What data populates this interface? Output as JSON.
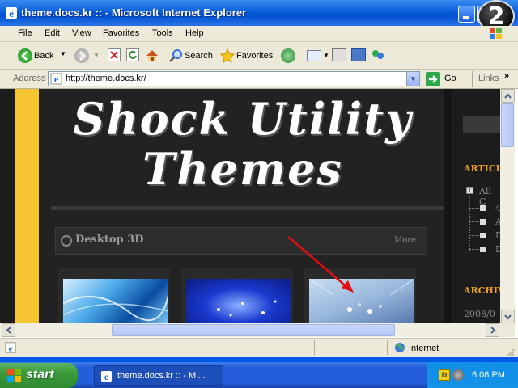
{
  "window": {
    "title": "theme.docs.kr :: - Microsoft Internet Explorer",
    "badge": "2"
  },
  "menu": [
    "File",
    "Edit",
    "View",
    "Favorites",
    "Tools",
    "Help"
  ],
  "toolbar": {
    "back_label": "Back",
    "search_label": "Search",
    "favorites_label": "Favorites"
  },
  "address": {
    "label": "Address",
    "url": "http://theme.docs.kr/",
    "go_label": "Go",
    "links_label": "Links"
  },
  "page": {
    "logo_line1": "Shock Utility",
    "logo_line2": "Themes",
    "section_title": "Desktop 3D",
    "more_link": "More...",
    "sidebar_heading1": "ARTICLE",
    "sidebar_all": "All C",
    "sidebar_items": [
      "4",
      "A",
      "D",
      "D"
    ],
    "sidebar_heading2": "ARCHIVE",
    "archive_item": "2008/0"
  },
  "status": {
    "zone": "Internet"
  },
  "taskbar": {
    "start_label": "start",
    "task_label": "theme.docs.kr :: - Mi...",
    "clock": "6:08 PM"
  }
}
